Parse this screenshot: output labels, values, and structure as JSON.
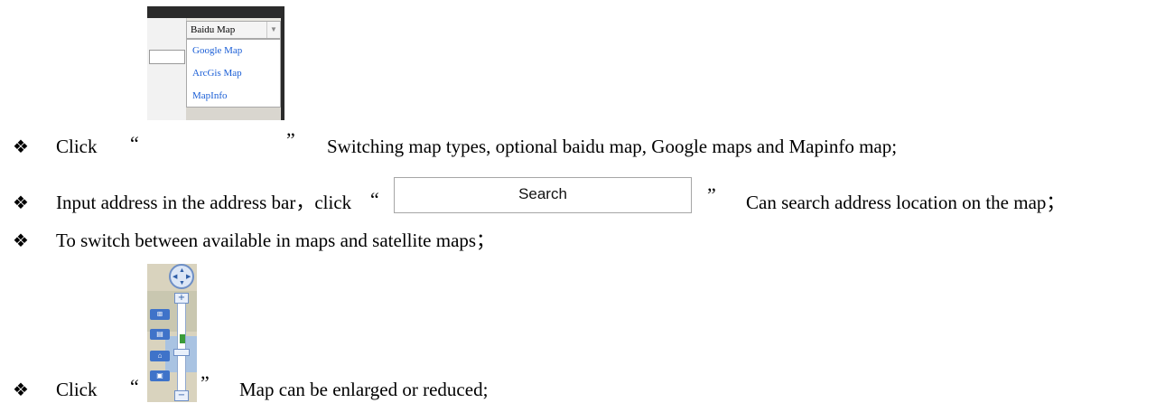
{
  "items": [
    {
      "text_before": "Click",
      "open_quote": "“",
      "close_quote": "”",
      "text_after": "Switching map types, optional baidu map, Google maps and Mapinfo map;"
    },
    {
      "text_before": "Input address in the address bar，click",
      "open_quote": "“",
      "close_quote": "”",
      "text_after": "Can search address location on the map；"
    },
    {
      "text": "To switch between available in maps and satellite maps；"
    },
    {
      "text_before": "Click",
      "open_quote": "“",
      "close_quote": "”",
      "text_after": "Map can be enlarged or reduced;"
    }
  ],
  "bullet_glyph": "❖",
  "map_type_dropdown": {
    "selected": "Baidu Map",
    "options": [
      "Google Map",
      "ArcGis Map",
      "MapInfo"
    ]
  },
  "search_button": {
    "label": "Search"
  },
  "colors": {
    "link_blue": "#1a5ed6",
    "control_blue": "#6e8fc6"
  }
}
